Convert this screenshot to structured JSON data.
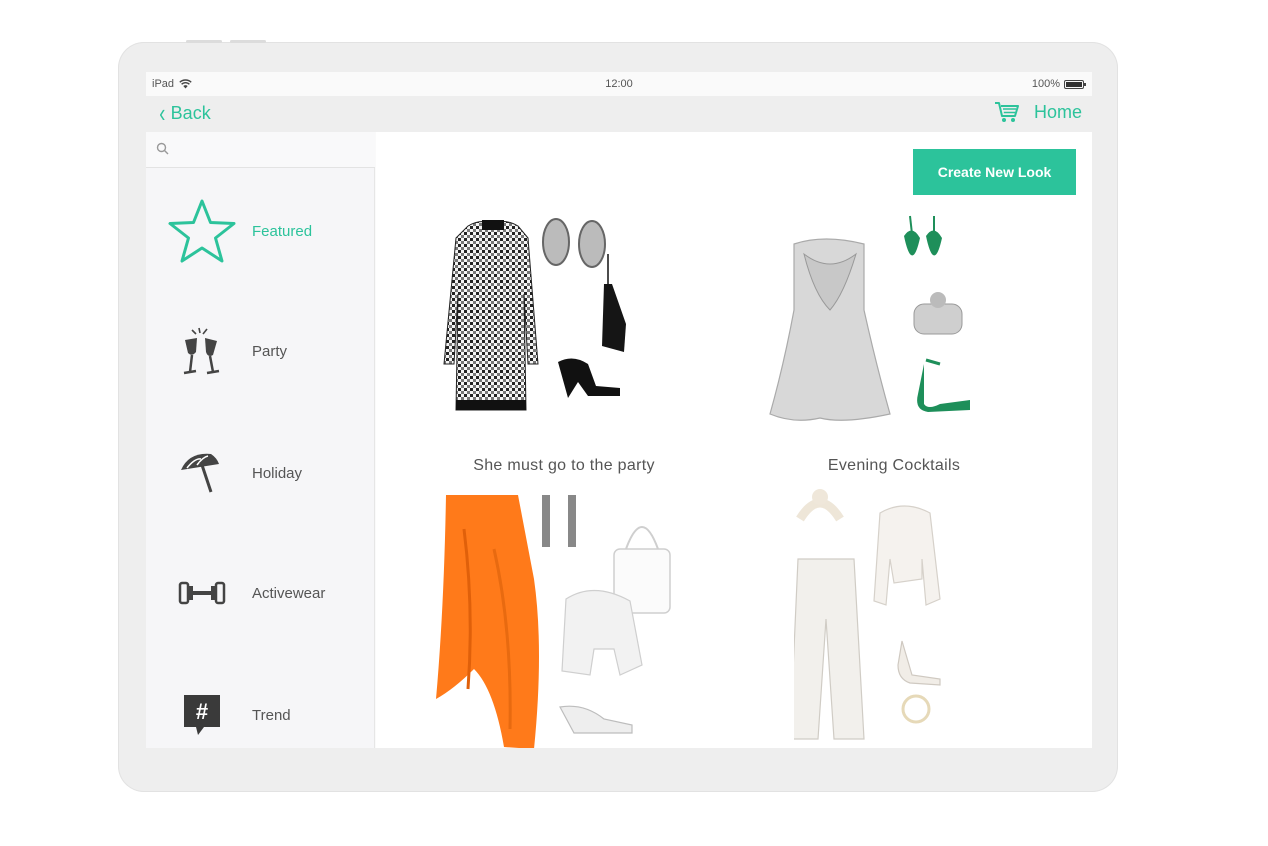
{
  "status_bar": {
    "device": "iPad",
    "time": "12:00",
    "battery": "100%"
  },
  "nav": {
    "back_label": "Back",
    "home_label": "Home"
  },
  "search": {
    "placeholder": ""
  },
  "sidebar": {
    "items": [
      {
        "label": "Featured",
        "icon": "star-icon",
        "active": true
      },
      {
        "label": "Party",
        "icon": "champagne-glasses-icon",
        "active": false
      },
      {
        "label": "Holiday",
        "icon": "beach-umbrella-icon",
        "active": false
      },
      {
        "label": "Activewear",
        "icon": "dumbbell-icon",
        "active": false
      },
      {
        "label": "Trend",
        "icon": "hashtag-bubble-icon",
        "active": false
      }
    ]
  },
  "main": {
    "create_button_label": "Create New Look",
    "looks": [
      {
        "title": "She must go to the party"
      },
      {
        "title": "Evening Cocktails"
      },
      {
        "title": ""
      },
      {
        "title": ""
      }
    ]
  },
  "colors": {
    "accent": "#2cc39b",
    "green_accessory": "#1e8f5a",
    "orange": "#ff7a1a"
  }
}
